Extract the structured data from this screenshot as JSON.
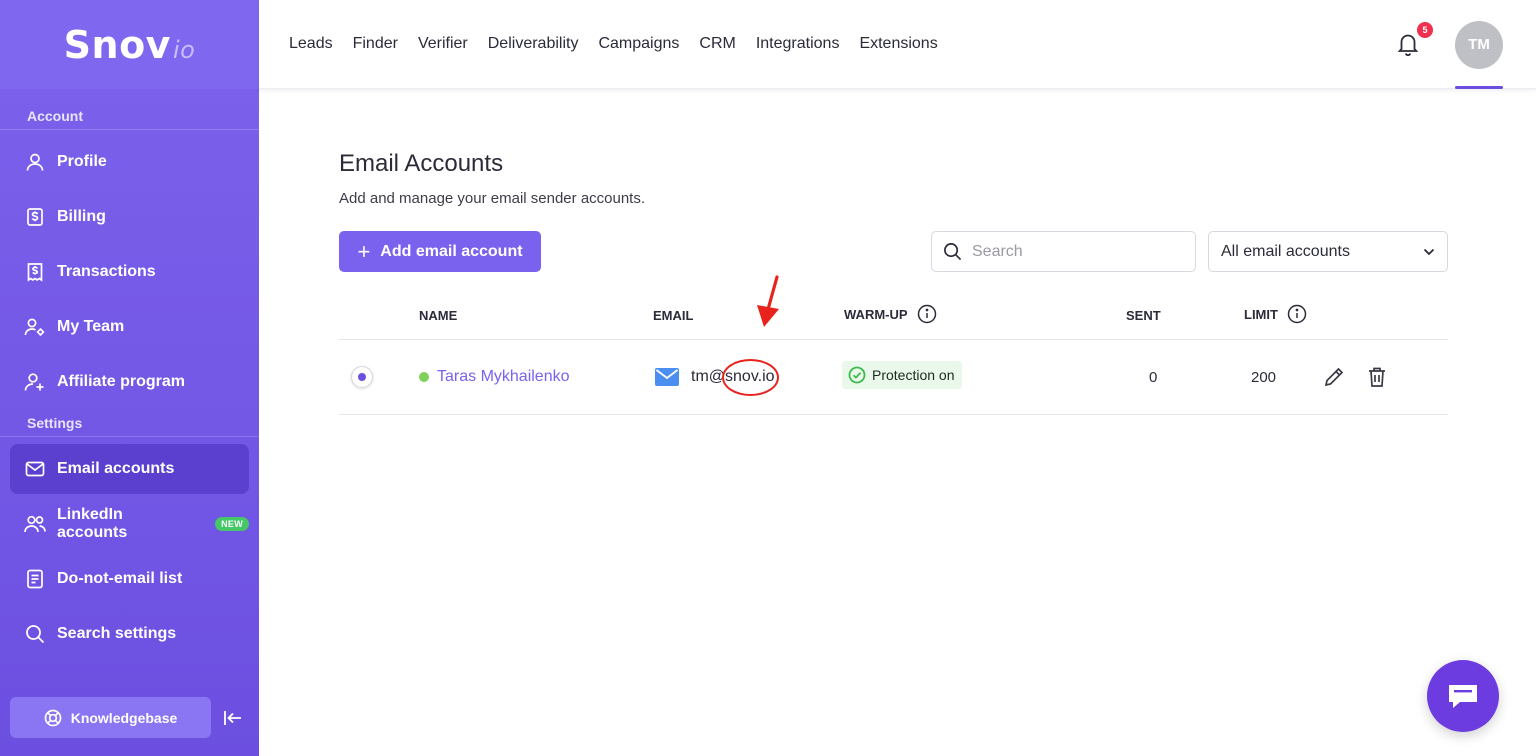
{
  "brand": {
    "name": "Snov",
    "suffix": "io"
  },
  "sidebar": {
    "sections": {
      "account": "Account",
      "settings": "Settings"
    },
    "account_items": [
      {
        "label": "Profile",
        "icon": "user-icon"
      },
      {
        "label": "Billing",
        "icon": "dollar-doc-icon"
      },
      {
        "label": "Transactions",
        "icon": "receipt-icon"
      },
      {
        "label": "My Team",
        "icon": "team-gear-icon"
      },
      {
        "label": "Affiliate program",
        "icon": "user-plus-icon"
      }
    ],
    "settings_items": [
      {
        "label": "Email accounts",
        "icon": "envelope-icon",
        "active": true
      },
      {
        "label": "LinkedIn accounts",
        "icon": "people-icon",
        "badge": "NEW"
      },
      {
        "label": "Do-not-email list",
        "icon": "list-doc-icon"
      },
      {
        "label": "Search settings",
        "icon": "search-icon"
      }
    ],
    "knowledgebase": "Knowledgebase"
  },
  "topnav": {
    "links": [
      "Leads",
      "Finder",
      "Verifier",
      "Deliverability",
      "Campaigns",
      "CRM",
      "Integrations",
      "Extensions"
    ],
    "notifications_count": "5",
    "avatar_initials": "TM"
  },
  "main": {
    "title": "Email Accounts",
    "subtitle": "Add and manage your email sender accounts.",
    "add_button": "Add email account",
    "search_placeholder": "Search",
    "filter_selected": "All email accounts",
    "columns": {
      "name": "NAME",
      "email": "EMAIL",
      "warmup": "WARM-UP",
      "sent": "SENT",
      "limit": "LIMIT"
    },
    "rows": [
      {
        "name": "Taras Mykhailenko",
        "email": "tm@snov.io",
        "warmup": "Protection on",
        "sent": "0",
        "limit": "200"
      }
    ]
  },
  "colors": {
    "accent": "#6c4fe0",
    "sidebar": "#7c62ec",
    "status_online": "#7fd15a",
    "warmup_bg": "#e9f8ea",
    "annotation_red": "#e8231e"
  }
}
